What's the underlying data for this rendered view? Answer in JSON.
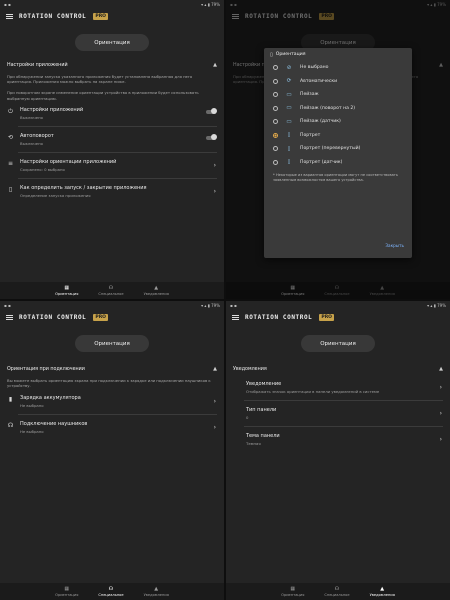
{
  "status": {
    "time": "21:43",
    "right": "▾ ▴ ▮ 79%"
  },
  "app": {
    "title": "ROTATION CONTROL",
    "badge": "PRO"
  },
  "pill": "Ориентация",
  "nav": [
    {
      "label": "Ориентация",
      "icon": "▦"
    },
    {
      "label": "Специальное",
      "icon": "☊"
    },
    {
      "label": "Уведомления",
      "icon": "▲"
    }
  ],
  "panel1": {
    "section_title": "Настройки приложений",
    "description_1": "При обнаружении запуска указанного приложения будет установлена выбранная для него ориентация. Приложения можно выбрать на экране ниже.",
    "description_2": "При поворотном экране изменение ориентации устройство в приложении будет использовать выбранную ориентацию.",
    "rows": [
      {
        "title": "Настройки приложений",
        "subtitle": "Выключено"
      },
      {
        "title": "Автоповорот",
        "subtitle": "Выключено"
      },
      {
        "title": "Настройки ориентации приложений",
        "subtitle": "Сохранено: 0 выбрано"
      },
      {
        "title": "Как определить запуск / закрытие приложения",
        "subtitle": "Определение запуска приложения"
      }
    ]
  },
  "dialog": {
    "title": "Ориентация",
    "options": [
      "Не выбрано",
      "Автоматически",
      "Пейзаж",
      "Пейзаж (поворот на 2)",
      "Пейзаж (датчик)",
      "Портрет",
      "Портрет (перевернутый)",
      "Портрет (датчик)"
    ],
    "selected_index": 5,
    "note": "* Некоторые из вариантов ориентации могут не соответствовать заявленным возможностям вашего устройства.",
    "close": "Закрыть"
  },
  "panel3": {
    "section_title": "Ориентация при подключении",
    "description": "Вы можете выбрать ориентацию экрана при подключении к зарядке или подключении наушников к устройству.",
    "rows": [
      {
        "title": "Зарядка аккумулятора",
        "subtitle": "Не выбрано"
      },
      {
        "title": "Подключение наушников",
        "subtitle": "Не выбрано"
      }
    ]
  },
  "panel4": {
    "section_title": "Уведомления",
    "rows": [
      {
        "title": "Уведомление",
        "subtitle": "Отображать значок ориентации в панели уведомлений в системе"
      },
      {
        "title": "Тип панели",
        "subtitle": "0"
      },
      {
        "title": "Тема панели",
        "subtitle": "Темная"
      }
    ]
  }
}
